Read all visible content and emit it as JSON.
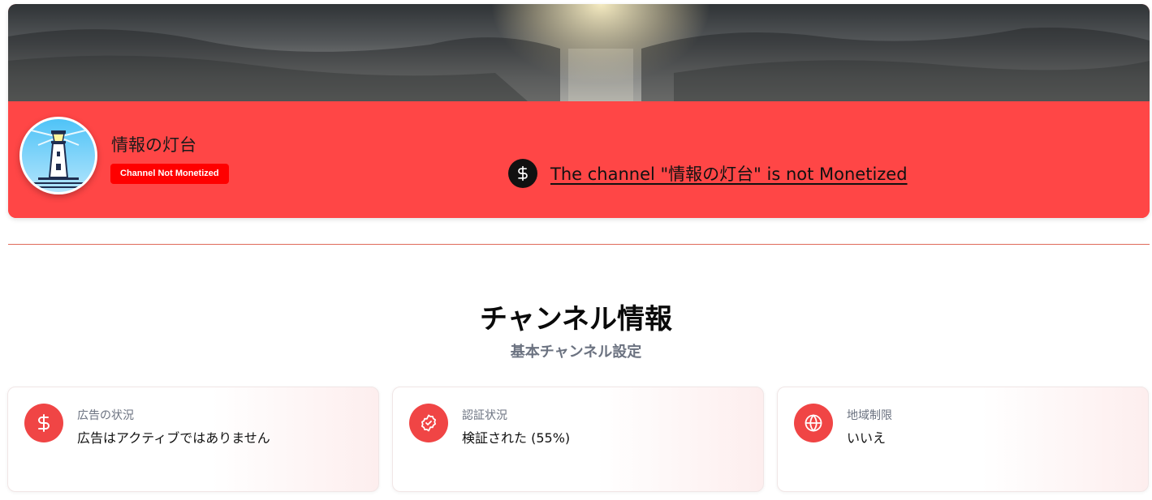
{
  "channel": {
    "name": "情報の灯台",
    "badge": "Channel Not Monetized",
    "monetization_message": "The channel \"情報の灯台\" is not Monetized",
    "monetization_icon": "dollar-icon",
    "avatar_icon": "lighthouse-icon"
  },
  "section": {
    "title": "チャンネル情報",
    "subtitle": "基本チャンネル設定"
  },
  "cards": [
    {
      "icon": "dollar-icon",
      "label": "広告の状況",
      "value": "広告はアクティブではありません"
    },
    {
      "icon": "verified-badge-icon",
      "label": "認証状況",
      "value": "検証された (55%)"
    },
    {
      "icon": "globe-icon",
      "label": "地域制限",
      "value": "いいえ"
    }
  ],
  "colors": {
    "accent_red": "#ff4646",
    "badge_red": "#ff0000",
    "icon_red": "#f04545",
    "muted_text": "#6b7280",
    "divider": "#e06a5a"
  }
}
